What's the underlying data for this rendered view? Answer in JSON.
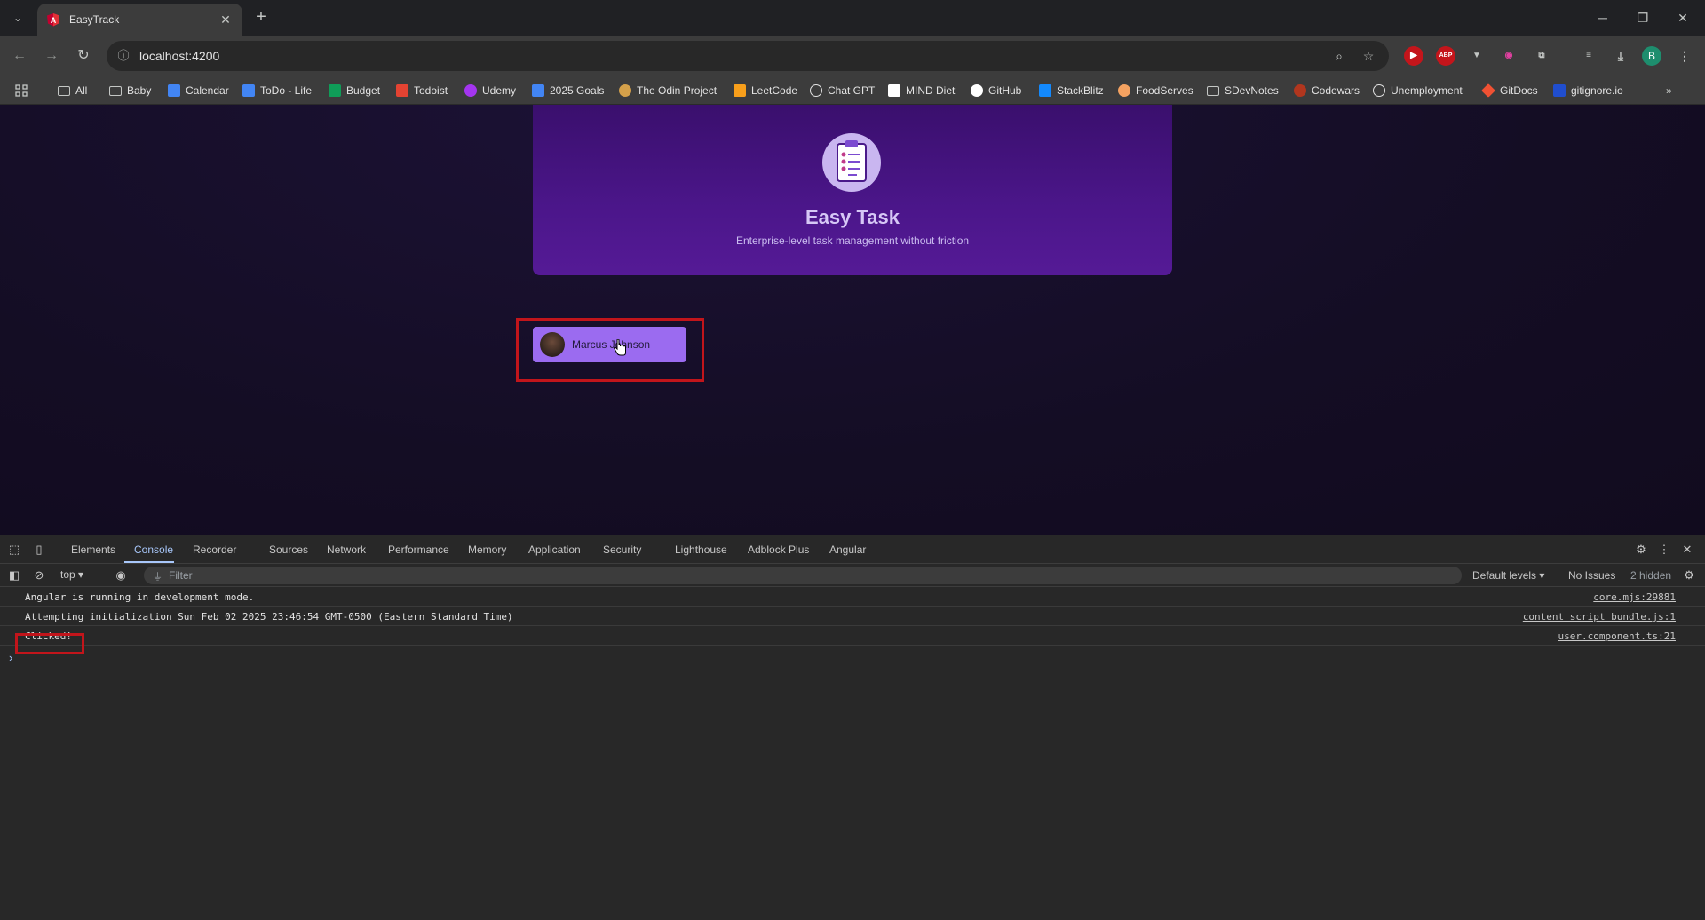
{
  "browser": {
    "tab_title": "EasyTrack",
    "url": "localhost:4200",
    "profile_initial": "B",
    "window_controls": [
      "minimize",
      "restore",
      "close"
    ]
  },
  "bookmarks": [
    {
      "label": "All",
      "icon": "folder-icon"
    },
    {
      "label": "Baby",
      "icon": "folder-icon"
    },
    {
      "label": "Calendar",
      "icon": "calendar-icon",
      "color": "#4285f4"
    },
    {
      "label": "ToDo - Life",
      "icon": "docs-icon",
      "color": "#4285f4"
    },
    {
      "label": "Budget",
      "icon": "sheets-icon",
      "color": "#0f9d58"
    },
    {
      "label": "Todoist",
      "icon": "todoist-icon",
      "color": "#e44332"
    },
    {
      "label": "Udemy",
      "icon": "udemy-icon",
      "color": "#a435f0"
    },
    {
      "label": "2025 Goals",
      "icon": "docs-icon",
      "color": "#4285f4"
    },
    {
      "label": "The Odin Project",
      "icon": "odin-icon",
      "color": "#d4a04a"
    },
    {
      "label": "LeetCode",
      "icon": "leetcode-icon",
      "color": "#f89f1b"
    },
    {
      "label": "Chat GPT",
      "icon": "openai-icon",
      "color": "#e3e3e3"
    },
    {
      "label": "MIND Diet",
      "icon": "notion-icon",
      "color": "#ffffff"
    },
    {
      "label": "GitHub",
      "icon": "github-icon",
      "color": "#ffffff"
    },
    {
      "label": "StackBlitz",
      "icon": "stackblitz-icon",
      "color": "#1389fd"
    },
    {
      "label": "FoodServes",
      "icon": "food-icon",
      "color": "#f4a261"
    },
    {
      "label": "SDevNotes",
      "icon": "folder-icon"
    },
    {
      "label": "Codewars",
      "icon": "codewars-icon",
      "color": "#b1361e"
    },
    {
      "label": "Unemployment",
      "icon": "globe-icon",
      "color": "#e3e3e3"
    },
    {
      "label": "GitDocs",
      "icon": "git-icon",
      "color": "#f05133"
    },
    {
      "label": "gitignore.io",
      "icon": "gitignore-icon",
      "color": "#204ecf"
    }
  ],
  "app": {
    "title": "Easy Task",
    "subtitle": "Enterprise-level task management without friction",
    "user_name": "Marcus Johnson"
  },
  "devtools": {
    "tabs": [
      "Elements",
      "Console",
      "Recorder",
      "Sources",
      "Network",
      "Performance",
      "Memory",
      "Application",
      "Security",
      "Lighthouse",
      "Adblock Plus",
      "Angular"
    ],
    "active_tab": "Console",
    "context": "top",
    "filter_placeholder": "Filter",
    "levels": "Default levels",
    "issues": "No Issues",
    "hidden": "2 hidden",
    "logs": [
      {
        "message": "Angular is running in development mode.",
        "source": "core.mjs:29881"
      },
      {
        "message": "Attempting initialization Sun Feb 02 2025 23:46:54 GMT-0500 (Eastern Standard Time)",
        "source": "content script bundle.js:1"
      },
      {
        "message": "Clicked!",
        "source": "user.component.ts:21"
      }
    ]
  },
  "colors": {
    "accent": "#a8c7fa",
    "highlight": "#c2151b",
    "user_button": "#9b6bf0"
  }
}
